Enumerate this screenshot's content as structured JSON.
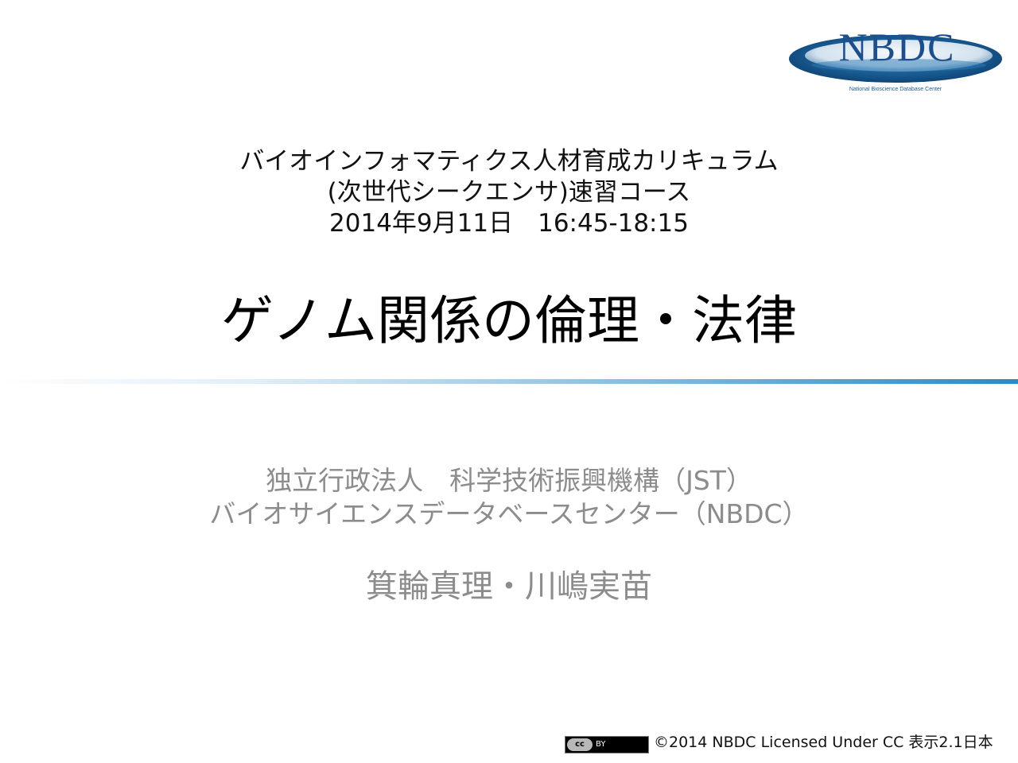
{
  "logo": {
    "text": "NBDC",
    "subtitle": "National Bioscience Database Center",
    "colors": {
      "ellipse": "#1a5e95",
      "text": "#1f4e8c"
    }
  },
  "course": {
    "line1": "バイオインフォマティクス人材育成カリキュラム",
    "line2": "(次世代シークエンサ)速習コース",
    "line3": "2014年9月11日　16:45-18:15"
  },
  "title": "ゲノム関係の倫理・法律",
  "organization": {
    "line1": "独立行政法人　科学技術振興機構（JST）",
    "line2": "バイオサイエンスデータベースセンター（NBDC）"
  },
  "authors": "箕輪真理・川嶋実苗",
  "license": {
    "badge_cc": "cc",
    "badge_by": "BY",
    "text": "©2014 NBDC Licensed Under CC 表示2.1日本"
  },
  "colors": {
    "divider": "#2b8ac4",
    "muted_text": "#8c8c8c"
  }
}
